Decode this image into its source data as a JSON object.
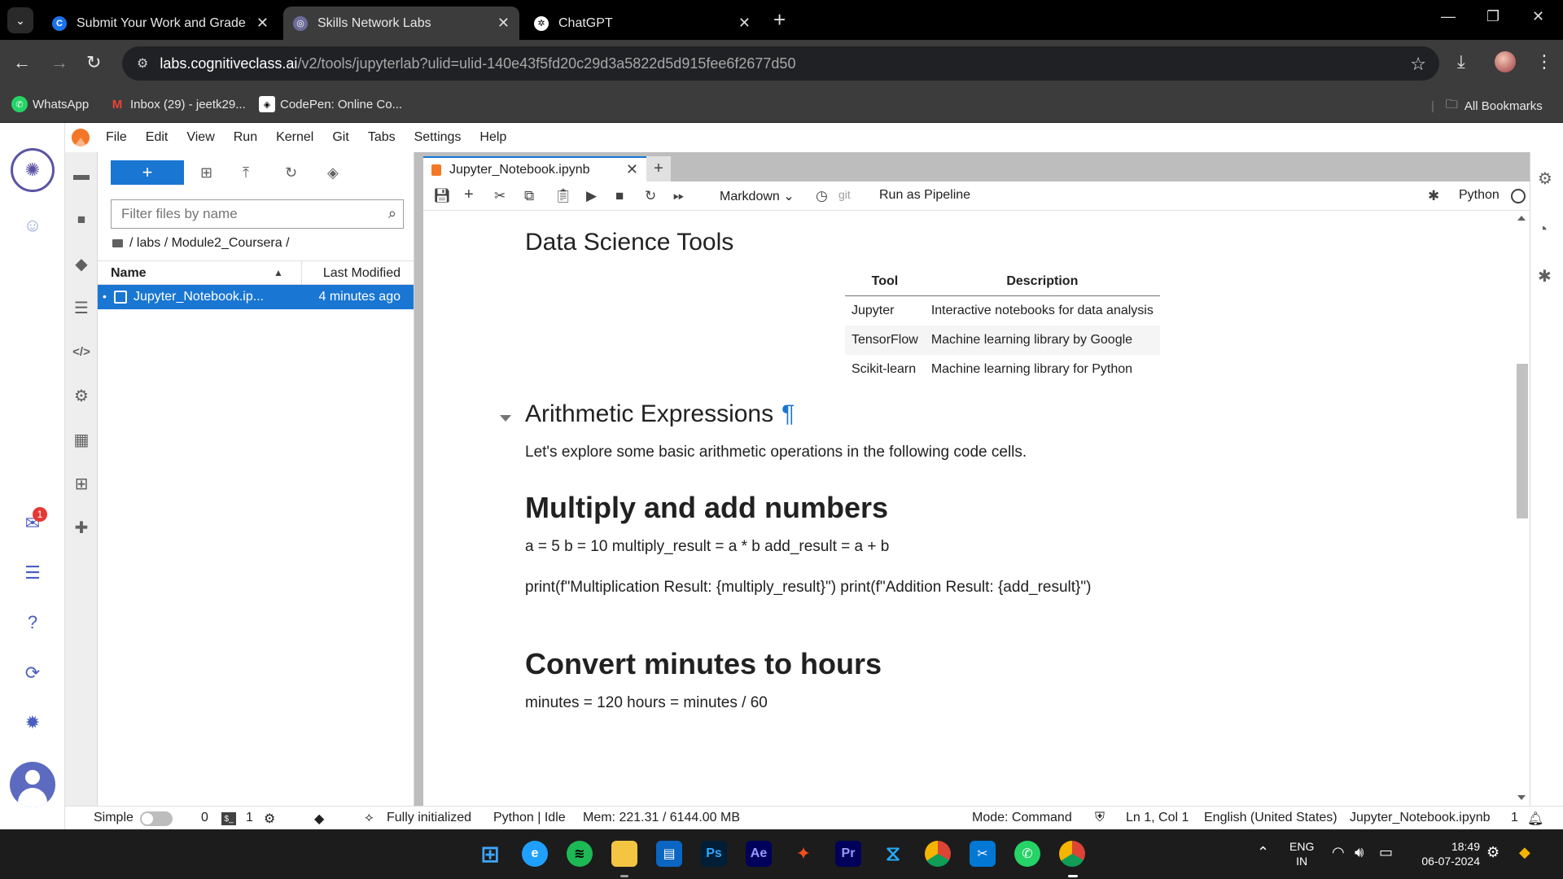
{
  "browser": {
    "tabs": [
      {
        "title": "Submit Your Work and Grade Yo",
        "favicon": "coursera-icon",
        "active": false
      },
      {
        "title": "Skills Network Labs",
        "favicon": "skills-network-icon",
        "active": true
      },
      {
        "title": "ChatGPT",
        "favicon": "chatgpt-icon",
        "active": false
      }
    ],
    "url_host": "labs.cognitiveclass.ai",
    "url_path": "/v2/tools/jupyterlab?ulid=ulid-140e43f5fd20c29d3a5822d5d915fee6f2677d50",
    "bookmarks": [
      {
        "label": "WhatsApp"
      },
      {
        "label": "Inbox (29) - jeetk29..."
      },
      {
        "label": "CodePen: Online Co..."
      }
    ],
    "all_bookmarks": "All Bookmarks"
  },
  "menu": [
    "File",
    "Edit",
    "View",
    "Run",
    "Kernel",
    "Git",
    "Tabs",
    "Settings",
    "Help"
  ],
  "rail": {
    "notification_count": "1"
  },
  "filebrowser": {
    "new_label": "+",
    "search_placeholder": "Filter files by name",
    "breadcrumb": "/ labs / Module2_Coursera /",
    "col_name": "Name",
    "col_modified": "Last Modified",
    "files": [
      {
        "name": "Jupyter_Notebook.ip...",
        "modified": "4 minutes ago"
      }
    ]
  },
  "notebook": {
    "tab_title": "Jupyter_Notebook.ipynb",
    "cell_type": "Markdown",
    "git_label": "git",
    "pipeline_label": "Run as Pipeline",
    "kernel_name": "Python",
    "tools_heading": "Data Science Tools",
    "table": {
      "headers": [
        "Tool",
        "Description"
      ],
      "rows": [
        [
          "Jupyter",
          "Interactive notebooks for data analysis"
        ],
        [
          "TensorFlow",
          "Machine learning library by Google"
        ],
        [
          "Scikit-learn",
          "Machine learning library for Python"
        ]
      ]
    },
    "arith_heading": "Arithmetic Expressions",
    "arith_anchor": "¶",
    "arith_text": "Let's explore some basic arithmetic operations in the following code cells.",
    "multiply_heading": "Multiply and add numbers",
    "multiply_code": "a = 5 b = 10 multiply_result = a * b add_result = a + b",
    "multiply_print": "print(f\"Multiplication Result: {multiply_result}\") print(f\"Addition Result: {add_result}\")",
    "convert_heading": "Convert minutes to hours",
    "convert_code": "minutes = 120 hours = minutes / 60"
  },
  "status": {
    "simple": "Simple",
    "terminals": "0",
    "kernels": "1",
    "init": "Fully initialized",
    "kernel_state": "Python | Idle",
    "memory": "Mem: 221.31 / 6144.00 MB",
    "mode": "Mode: Command",
    "position": "Ln 1, Col 1",
    "language": "English (United States)",
    "filename": "Jupyter_Notebook.ipynb",
    "notifications": "1"
  },
  "taskbar": {
    "lang_line1": "ENG",
    "lang_line2": "IN",
    "time": "18:49",
    "date": "06-07-2024"
  }
}
